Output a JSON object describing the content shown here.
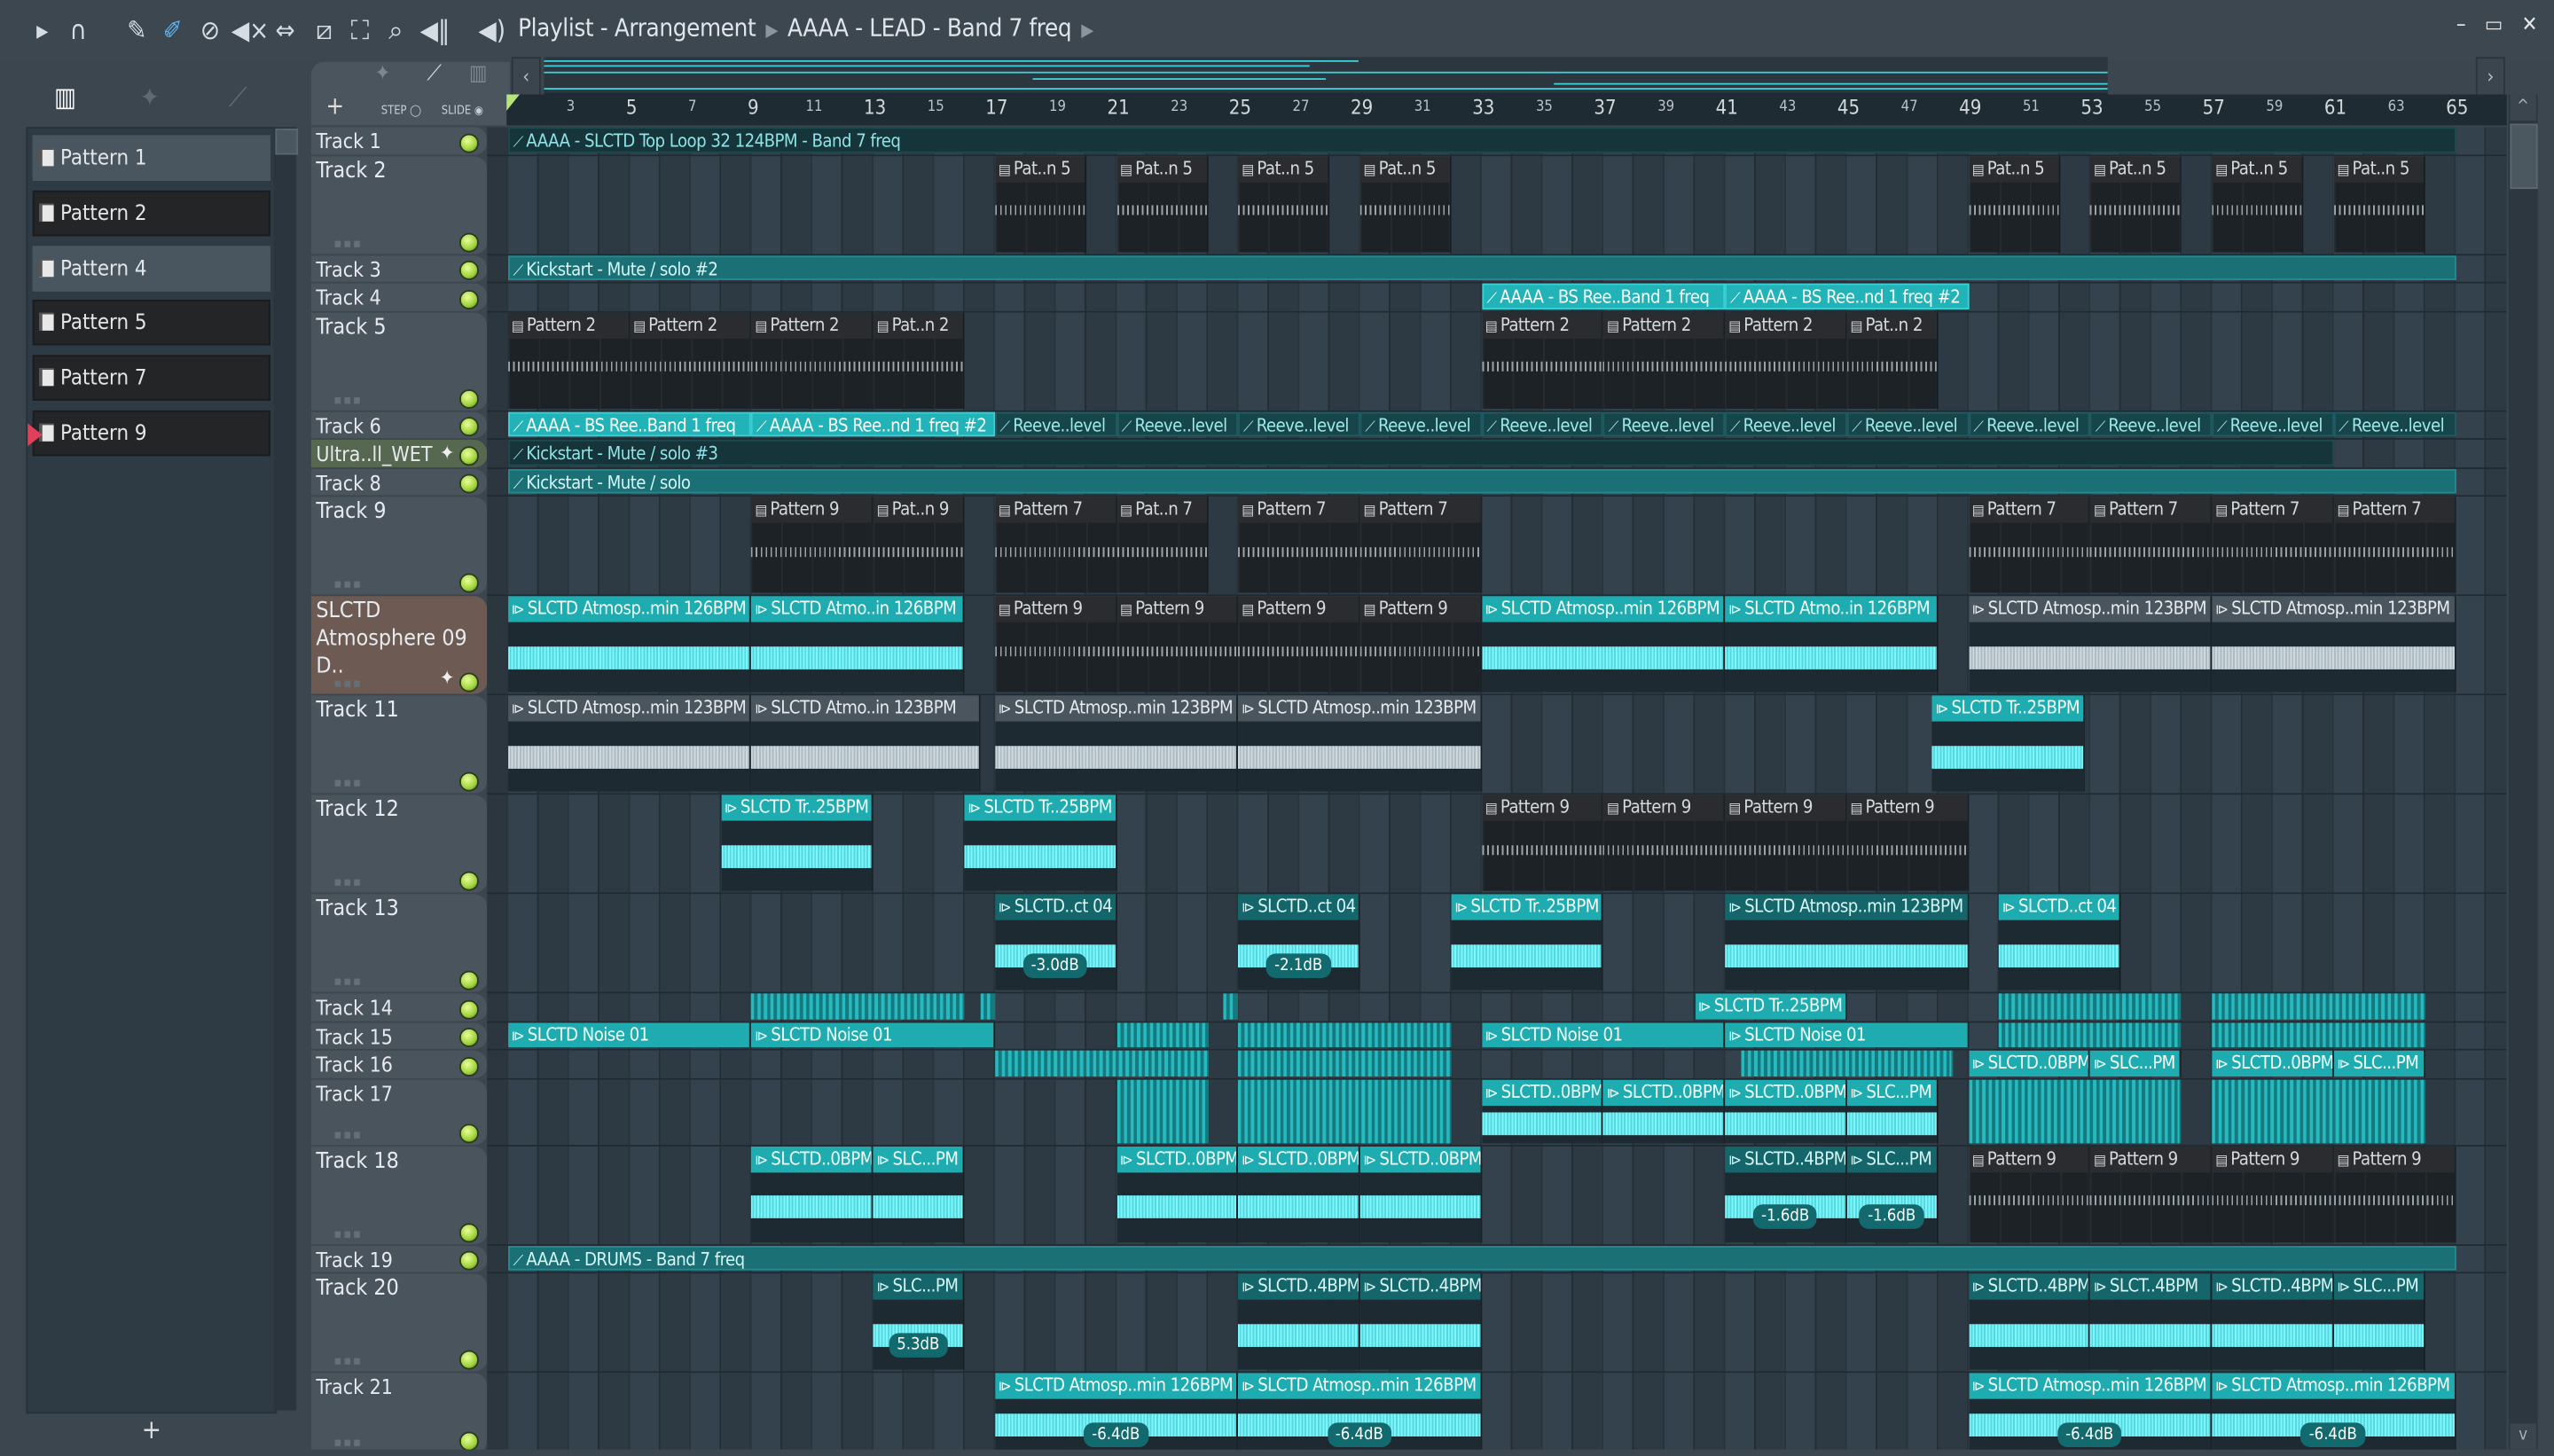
{
  "toolbar": {
    "title": "Playlist - Arrangement",
    "breadcrumb": "AAAA - LEAD - Band 7 freq",
    "step_label": "STEP",
    "slide_label": "SLIDE"
  },
  "patterns": [
    {
      "label": "Pattern 1",
      "selected": true
    },
    {
      "label": "Pattern 2",
      "selected": false
    },
    {
      "label": "Pattern 4",
      "selected": true
    },
    {
      "label": "Pattern 5",
      "selected": false
    },
    {
      "label": "Pattern 7",
      "selected": false
    },
    {
      "label": "Pattern 9",
      "selected": false,
      "current": true
    }
  ],
  "ruler": {
    "labels": [
      3,
      5,
      7,
      9,
      11,
      13,
      15,
      17,
      19,
      21,
      23,
      25,
      27,
      29,
      31,
      33,
      35,
      37,
      39,
      41,
      43,
      45,
      47,
      49,
      51,
      53,
      55,
      57,
      59,
      61,
      63,
      65
    ]
  },
  "colors": {
    "accent": "#22b3b8",
    "led": "#9ed23a",
    "playhead": "#b7e47a",
    "current_pattern_marker": "#e0405a"
  },
  "tracks": [
    {
      "name": "Track 1",
      "size": "s",
      "clips": [
        {
          "s": 1,
          "l": 64,
          "t": "AAAA - SLCTD Top Loop 32 124BPM - Band 7 freq",
          "k": "autodark"
        }
      ]
    },
    {
      "name": "Track 2",
      "size": "l",
      "clips": [
        {
          "s": 17,
          "l": 3,
          "t": "Pat..n 5",
          "k": "pattern"
        },
        {
          "s": 21,
          "l": 3,
          "t": "Pat..n 5",
          "k": "pattern"
        },
        {
          "s": 25,
          "l": 3,
          "t": "Pat..n 5",
          "k": "pattern"
        },
        {
          "s": 29,
          "l": 3,
          "t": "Pat..n 5",
          "k": "pattern"
        },
        {
          "s": 49,
          "l": 3,
          "t": "Pat..n 5",
          "k": "pattern"
        },
        {
          "s": 53,
          "l": 3,
          "t": "Pat..n 5",
          "k": "pattern"
        },
        {
          "s": 57,
          "l": 3,
          "t": "Pat..n 5",
          "k": "pattern"
        },
        {
          "s": 61,
          "l": 3,
          "t": "Pat..n 5",
          "k": "pattern"
        }
      ]
    },
    {
      "name": "Track 3",
      "size": "s",
      "clips": [
        {
          "s": 1,
          "l": 64,
          "t": "Kickstart - Mute / solo #2",
          "k": "autoteal"
        }
      ]
    },
    {
      "name": "Track 4",
      "size": "s",
      "clips": [
        {
          "s": 33,
          "l": 8,
          "t": "AAAA - BS Ree..Band 1 freq",
          "k": "autobright"
        },
        {
          "s": 41,
          "l": 8,
          "t": "AAAA - BS Ree..nd 1 freq #2",
          "k": "autobright"
        }
      ]
    },
    {
      "name": "Track 5",
      "size": "l",
      "clips": [
        {
          "s": 1,
          "l": 4,
          "t": "Pattern 2",
          "k": "pattern"
        },
        {
          "s": 5,
          "l": 4,
          "t": "Pattern 2",
          "k": "pattern"
        },
        {
          "s": 9,
          "l": 4,
          "t": "Pattern 2",
          "k": "pattern"
        },
        {
          "s": 13,
          "l": 3,
          "t": "Pat..n 2",
          "k": "pattern"
        },
        {
          "s": 33,
          "l": 4,
          "t": "Pattern 2",
          "k": "pattern"
        },
        {
          "s": 37,
          "l": 4,
          "t": "Pattern 2",
          "k": "pattern"
        },
        {
          "s": 41,
          "l": 4,
          "t": "Pattern 2",
          "k": "pattern"
        },
        {
          "s": 45,
          "l": 3,
          "t": "Pat..n 2",
          "k": "pattern"
        }
      ]
    },
    {
      "name": "Track 6",
      "size": "s",
      "clips": [
        {
          "s": 1,
          "l": 8,
          "t": "AAAA - BS Ree..Band 1 freq",
          "k": "autobright"
        },
        {
          "s": 9,
          "l": 8,
          "t": "AAAA - BS Ree..nd 1 freq #2",
          "k": "autobright"
        },
        {
          "s": 17,
          "l": 4,
          "t": "Reeve..level",
          "k": "reeve"
        },
        {
          "s": 21,
          "l": 4,
          "t": "Reeve..level",
          "k": "reeve"
        },
        {
          "s": 25,
          "l": 4,
          "t": "Reeve..level",
          "k": "reeve"
        },
        {
          "s": 29,
          "l": 4,
          "t": "Reeve..level",
          "k": "reeve"
        },
        {
          "s": 33,
          "l": 4,
          "t": "Reeve..level",
          "k": "reeve"
        },
        {
          "s": 37,
          "l": 4,
          "t": "Reeve..level",
          "k": "reeve"
        },
        {
          "s": 41,
          "l": 4,
          "t": "Reeve..level",
          "k": "reeve"
        },
        {
          "s": 45,
          "l": 4,
          "t": "Reeve..level",
          "k": "reeve"
        },
        {
          "s": 49,
          "l": 4,
          "t": "Reeve..level",
          "k": "reeve"
        },
        {
          "s": 53,
          "l": 4,
          "t": "Reeve..level",
          "k": "reeve"
        },
        {
          "s": 57,
          "l": 4,
          "t": "Reeve..level",
          "k": "reeve"
        },
        {
          "s": 61,
          "l": 4,
          "t": "Reeve..level",
          "k": "reeve"
        }
      ]
    },
    {
      "name": "Ultra..ll_WET",
      "size": "s",
      "tint": "#56684f",
      "audio": true,
      "clips": [
        {
          "s": 1,
          "l": 60,
          "t": "Kickstart - Mute / solo #3",
          "k": "autodark"
        }
      ]
    },
    {
      "name": "Track 8",
      "size": "s",
      "clips": [
        {
          "s": 1,
          "l": 64,
          "t": "Kickstart - Mute / solo",
          "k": "autoteal"
        }
      ]
    },
    {
      "name": "Track 9",
      "size": "l",
      "clips": [
        {
          "s": 9,
          "l": 4,
          "t": "Pattern 9",
          "k": "pattern"
        },
        {
          "s": 13,
          "l": 3,
          "t": "Pat..n 9",
          "k": "pattern"
        },
        {
          "s": 17,
          "l": 4,
          "t": "Pattern 7",
          "k": "pattern"
        },
        {
          "s": 21,
          "l": 3,
          "t": "Pat..n 7",
          "k": "pattern"
        },
        {
          "s": 25,
          "l": 4,
          "t": "Pattern 7",
          "k": "pattern"
        },
        {
          "s": 29,
          "l": 4,
          "t": "Pattern 7",
          "k": "pattern"
        },
        {
          "s": 49,
          "l": 4,
          "t": "Pattern 7",
          "k": "pattern"
        },
        {
          "s": 53,
          "l": 4,
          "t": "Pattern 7",
          "k": "pattern"
        },
        {
          "s": 57,
          "l": 4,
          "t": "Pattern 7",
          "k": "pattern"
        },
        {
          "s": 61,
          "l": 4,
          "t": "Pattern 7",
          "k": "pattern"
        }
      ]
    },
    {
      "name": "SLCTD Atmosphere 09 D..",
      "size": "l",
      "tint": "#6d5b53",
      "audio": true,
      "clips": [
        {
          "s": 1,
          "l": 8,
          "t": "SLCTD Atmosp..min 126BPM",
          "k": "audiobright"
        },
        {
          "s": 9,
          "l": 7,
          "t": "SLCTD Atmo..in 126BPM",
          "k": "audiobright"
        },
        {
          "s": 17,
          "l": 4,
          "t": "Pattern 9",
          "k": "pattern"
        },
        {
          "s": 21,
          "l": 4,
          "t": "Pattern 9",
          "k": "pattern"
        },
        {
          "s": 25,
          "l": 4,
          "t": "Pattern 9",
          "k": "pattern"
        },
        {
          "s": 29,
          "l": 4,
          "t": "Pattern 9",
          "k": "pattern"
        },
        {
          "s": 33,
          "l": 8,
          "t": "SLCTD Atmosp..min 126BPM",
          "k": "audiobright"
        },
        {
          "s": 41,
          "l": 7,
          "t": "SLCTD Atmo..in 126BPM",
          "k": "audiobright"
        },
        {
          "s": 49,
          "l": 8,
          "t": "SLCTD Atmosp..min 123BPM",
          "k": "audiogrey"
        },
        {
          "s": 57,
          "l": 8,
          "t": "SLCTD Atmosp..min 123BPM",
          "k": "audiogrey"
        }
      ]
    },
    {
      "name": "Track 11",
      "size": "l",
      "clips": [
        {
          "s": 1,
          "l": 8,
          "t": "SLCTD Atmosp..min 123BPM",
          "k": "audiogrey"
        },
        {
          "s": 9,
          "l": 7.5,
          "t": "SLCTD Atmo..in 123BPM",
          "k": "audiogrey"
        },
        {
          "s": 17,
          "l": 8,
          "t": "SLCTD Atmosp..min 123BPM",
          "k": "audiogrey"
        },
        {
          "s": 25,
          "l": 8,
          "t": "SLCTD Atmosp..min 123BPM",
          "k": "audiogrey"
        },
        {
          "s": 47.8,
          "l": 5,
          "t": "SLCTD Tr..25BPM",
          "k": "audiobright"
        }
      ]
    },
    {
      "name": "Track 12",
      "size": "l",
      "clips": [
        {
          "s": 8,
          "l": 5,
          "t": "SLCTD Tr..25BPM",
          "k": "audiobright"
        },
        {
          "s": 16,
          "l": 5,
          "t": "SLCTD Tr..25BPM",
          "k": "audiobright"
        },
        {
          "s": 33,
          "l": 4,
          "t": "Pattern 9",
          "k": "pattern"
        },
        {
          "s": 37,
          "l": 4,
          "t": "Pattern 9",
          "k": "pattern"
        },
        {
          "s": 41,
          "l": 4,
          "t": "Pattern 9",
          "k": "pattern"
        },
        {
          "s": 45,
          "l": 4,
          "t": "Pattern 9",
          "k": "pattern"
        }
      ]
    },
    {
      "name": "Track 13",
      "size": "l",
      "clips": [
        {
          "s": 17,
          "l": 4,
          "t": "SLCTD..ct 04",
          "k": "audiodark",
          "db": "-3.0dB"
        },
        {
          "s": 25,
          "l": 4,
          "t": "SLCTD..ct 04",
          "k": "audiodark",
          "db": "-2.1dB"
        },
        {
          "s": 32,
          "l": 5,
          "t": "SLCTD Tr..25BPM",
          "k": "audiobright"
        },
        {
          "s": 41,
          "l": 8,
          "t": "SLCTD Atmosp..min 123BPM",
          "k": "audiodark"
        },
        {
          "s": 50,
          "l": 4,
          "t": "SLCTD..ct 04",
          "k": "audiobright"
        }
      ]
    },
    {
      "name": "Track 14",
      "size": "s",
      "clips": [
        {
          "s": 9,
          "l": 7,
          "t": "",
          "k": "stripes"
        },
        {
          "s": 16.5,
          "l": 0.5,
          "t": "",
          "k": "stripes"
        },
        {
          "s": 24.5,
          "l": 0.5,
          "t": "",
          "k": "stripes"
        },
        {
          "s": 40,
          "l": 5,
          "t": "SLCTD Tr..25BPM",
          "k": "audiobright"
        },
        {
          "s": 50,
          "l": 6,
          "t": "",
          "k": "stripes"
        },
        {
          "s": 57,
          "l": 7,
          "t": "",
          "k": "stripes"
        }
      ]
    },
    {
      "name": "Track 15",
      "size": "s",
      "clips": [
        {
          "s": 1,
          "l": 8,
          "t": "SLCTD Noise 01",
          "k": "audiobright"
        },
        {
          "s": 9,
          "l": 8,
          "t": "SLCTD Noise 01",
          "k": "audiobright"
        },
        {
          "s": 21,
          "l": 3,
          "t": "",
          "k": "stripes"
        },
        {
          "s": 25,
          "l": 7,
          "t": "",
          "k": "stripes"
        },
        {
          "s": 33,
          "l": 8,
          "t": "SLCTD Noise 01",
          "k": "audiobright"
        },
        {
          "s": 41,
          "l": 8,
          "t": "SLCTD Noise 01",
          "k": "audiobright"
        },
        {
          "s": 50,
          "l": 6,
          "t": "",
          "k": "stripes"
        },
        {
          "s": 57,
          "l": 7,
          "t": "",
          "k": "stripes"
        }
      ]
    },
    {
      "name": "Track 16",
      "size": "s",
      "clips": [
        {
          "s": 17,
          "l": 7,
          "t": "",
          "k": "stripes"
        },
        {
          "s": 25,
          "l": 7,
          "t": "",
          "k": "stripes"
        },
        {
          "s": 41.5,
          "l": 7,
          "t": "",
          "k": "stripes"
        },
        {
          "s": 49,
          "l": 4,
          "t": "SLCTD..0BPM",
          "k": "audiobright"
        },
        {
          "s": 53,
          "l": 3,
          "t": "SLC...PM",
          "k": "audiobright"
        },
        {
          "s": 57,
          "l": 4,
          "t": "SLCTD..0BPM",
          "k": "audiobright"
        },
        {
          "s": 61,
          "l": 3,
          "t": "SLC...PM",
          "k": "audiobright"
        }
      ]
    },
    {
      "name": "Track 17",
      "size": "m",
      "clips": [
        {
          "s": 21,
          "l": 3,
          "t": "",
          "k": "stripes"
        },
        {
          "s": 25,
          "l": 7,
          "t": "",
          "k": "stripes"
        },
        {
          "s": 33,
          "l": 4,
          "t": "SLCTD..0BPM",
          "k": "audiobright"
        },
        {
          "s": 37,
          "l": 4,
          "t": "SLCTD..0BPM",
          "k": "audiobright"
        },
        {
          "s": 41,
          "l": 4,
          "t": "SLCTD..0BPM",
          "k": "audiobright"
        },
        {
          "s": 45,
          "l": 3,
          "t": "SLC...PM",
          "k": "audiobright"
        },
        {
          "s": 49,
          "l": 7,
          "t": "",
          "k": "stripes"
        },
        {
          "s": 57,
          "l": 7,
          "t": "",
          "k": "stripes"
        }
      ]
    },
    {
      "name": "Track 18",
      "size": "l",
      "clips": [
        {
          "s": 9,
          "l": 4,
          "t": "SLCTD..0BPM",
          "k": "audiobright"
        },
        {
          "s": 13,
          "l": 3,
          "t": "SLC...PM",
          "k": "audiobright"
        },
        {
          "s": 21,
          "l": 4,
          "t": "SLCTD..0BPM",
          "k": "audiobright"
        },
        {
          "s": 25,
          "l": 4,
          "t": "SLCTD..0BPM",
          "k": "audiobright"
        },
        {
          "s": 29,
          "l": 4,
          "t": "SLCTD..0BPM",
          "k": "audiobright"
        },
        {
          "s": 41,
          "l": 4,
          "t": "SLCTD..4BPM",
          "k": "audiodark",
          "db": "-1.6dB"
        },
        {
          "s": 45,
          "l": 3,
          "t": "SLC...PM",
          "k": "audiodark",
          "db": "-1.6dB"
        },
        {
          "s": 49,
          "l": 4,
          "t": "Pattern 9",
          "k": "pattern"
        },
        {
          "s": 53,
          "l": 4,
          "t": "Pattern 9",
          "k": "pattern"
        },
        {
          "s": 57,
          "l": 4,
          "t": "Pattern 9",
          "k": "pattern"
        },
        {
          "s": 61,
          "l": 4,
          "t": "Pattern 9",
          "k": "pattern"
        }
      ]
    },
    {
      "name": "Track 19",
      "size": "s",
      "clips": [
        {
          "s": 1,
          "l": 64,
          "t": "AAAA - DRUMS - Band 7 freq",
          "k": "autoteal"
        }
      ]
    },
    {
      "name": "Track 20",
      "size": "l",
      "clips": [
        {
          "s": 13,
          "l": 3,
          "t": "SLC...PM",
          "k": "audiodark",
          "db": "5.3dB"
        },
        {
          "s": 25,
          "l": 4,
          "t": "SLCTD..4BPM",
          "k": "audiodark"
        },
        {
          "s": 29,
          "l": 4,
          "t": "SLCTD..4BPM",
          "k": "audiodark"
        },
        {
          "s": 49,
          "l": 4,
          "t": "SLCTD..4BPM",
          "k": "audiodark"
        },
        {
          "s": 53,
          "l": 4,
          "t": "SLCT..4BPM",
          "k": "audiodark"
        },
        {
          "s": 57,
          "l": 4,
          "t": "SLCTD..4BPM",
          "k": "audiodark"
        },
        {
          "s": 61,
          "l": 3,
          "t": "SLC...PM",
          "k": "audiodark"
        }
      ]
    },
    {
      "name": "Track 21",
      "size": "x",
      "clips": [
        {
          "s": 17,
          "l": 8,
          "t": "SLCTD Atmosp..min 126BPM",
          "k": "audiobright",
          "db": "-6.4dB"
        },
        {
          "s": 25,
          "l": 8,
          "t": "SLCTD Atmosp..min 126BPM",
          "k": "audiobright",
          "db": "-6.4dB"
        },
        {
          "s": 49,
          "l": 8,
          "t": "SLCTD Atmosp..min 126BPM",
          "k": "audiobright",
          "db": "-6.4dB"
        },
        {
          "s": 57,
          "l": 8,
          "t": "SLCTD Atmosp..min 126BPM",
          "k": "audiobright",
          "db": "-6.4dB"
        }
      ]
    }
  ]
}
